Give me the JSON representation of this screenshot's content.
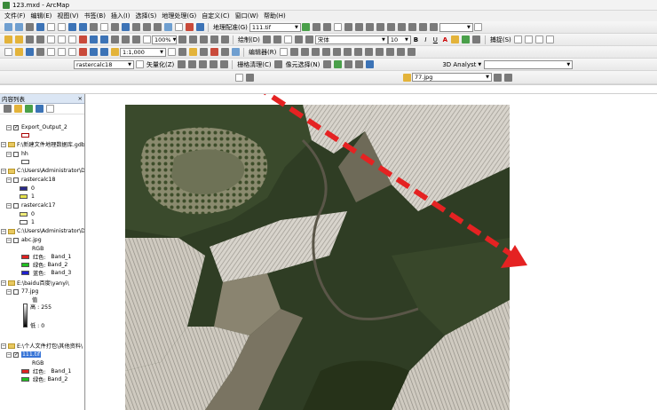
{
  "window": {
    "title": "123.mxd - ArcMap"
  },
  "menu": [
    "文件(F)",
    "编辑(E)",
    "视图(V)",
    "书签(B)",
    "插入(I)",
    "选择(S)",
    "地理处理(G)",
    "自定义(C)",
    "窗口(W)",
    "帮助(H)"
  ],
  "toolbar1": {
    "georef_label": "地理配准(G)",
    "layer_combo": "111.tif"
  },
  "toolbar2": {
    "zoom_combo": "100%",
    "draw_label": "绘制(D)",
    "font_combo": "宋体",
    "size_combo": "10",
    "bold": "B",
    "italic": "I",
    "underline": "U",
    "a_label": "A",
    "capture_label": "捕捉(S)"
  },
  "toolbar3": {
    "scale_combo": "1:1,000",
    "editor_label": "编辑器(R)"
  },
  "toolbar4": {
    "raster_combo": "rastercalc18",
    "vectorize_label": "矢量化(Z)",
    "raster_clean_label": "栅格清理(C)",
    "cell_select_label": "像元选择(N)",
    "analyst_label": "3D Analyst",
    "image_combo": "77.jpg"
  },
  "toc": {
    "title": "内容列表",
    "rows": [
      {
        "type": "layer",
        "checked": true,
        "label": "Export_Output_2"
      },
      {
        "type": "folder",
        "label": "F:\\新建文件地理数据库.gdb"
      },
      {
        "type": "layer",
        "checked": false,
        "label": "hh"
      },
      {
        "type": "folder",
        "label": "C:\\Users\\Administrator\\D"
      },
      {
        "type": "layer",
        "checked": false,
        "label": "rastercalc18"
      },
      {
        "type": "legend",
        "label": "0",
        "color": "#2a2a8a"
      },
      {
        "type": "legend",
        "label": "1",
        "color": "#e6e24a"
      },
      {
        "type": "layer",
        "checked": false,
        "label": "rastercalc17"
      },
      {
        "type": "legend",
        "label": "0",
        "color": "#f0ec7a"
      },
      {
        "type": "legend",
        "label": "1",
        "color": "#ffffff"
      },
      {
        "type": "folder",
        "label": "C:\\Users\\Administrator\\D"
      },
      {
        "type": "layer",
        "checked": false,
        "label": "abc.jpg"
      },
      {
        "type": "text",
        "label": "RGB"
      },
      {
        "type": "band",
        "label": "红色:",
        "band": "Band_1",
        "color": "#e02020"
      },
      {
        "type": "band",
        "label": "绿色:",
        "band": "Band_2",
        "color": "#20c020"
      },
      {
        "type": "band",
        "label": "蓝色:",
        "band": "Band_3",
        "color": "#2020d0"
      },
      {
        "type": "folder",
        "label": "E:\\baidu百度\\yanyi\\"
      },
      {
        "type": "layer",
        "checked": false,
        "label": "77.jpg"
      },
      {
        "type": "text",
        "label": "值"
      },
      {
        "type": "ramp",
        "high": "高 : 255",
        "low": "低 : 0"
      },
      {
        "type": "folder",
        "label": "E:\\个人文件打包\\其他资料\\"
      },
      {
        "type": "layer",
        "checked": true,
        "label": "111.tif",
        "selected": true
      },
      {
        "type": "text",
        "label": "RGB"
      },
      {
        "type": "band",
        "label": "红色:",
        "band": "Band_1",
        "color": "#e02020"
      },
      {
        "type": "band",
        "label": "绿色:",
        "band": "Band_2",
        "color": "#20c020"
      }
    ]
  },
  "colors": {
    "selection": "#3875d7",
    "arrow": "#e52222",
    "toc_header": "#dbe6f4"
  }
}
